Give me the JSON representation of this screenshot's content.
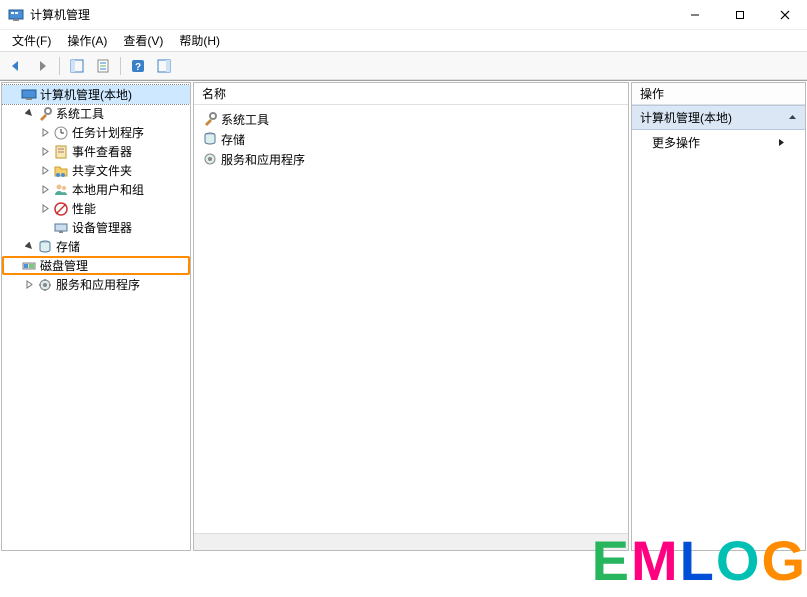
{
  "titlebar": {
    "title": "计算机管理"
  },
  "menu": {
    "file": "文件(F)",
    "action": "操作(A)",
    "view": "查看(V)",
    "help": "帮助(H)"
  },
  "tree": {
    "root": "计算机管理(本地)",
    "system_tools": "系统工具",
    "task_scheduler": "任务计划程序",
    "event_viewer": "事件查看器",
    "shared_folders": "共享文件夹",
    "local_users": "本地用户和组",
    "performance": "性能",
    "device_manager": "设备管理器",
    "storage": "存储",
    "disk_management": "磁盘管理",
    "services_apps": "服务和应用程序"
  },
  "list": {
    "header": "名称",
    "items": {
      "system_tools": "系统工具",
      "storage": "存储",
      "services_apps": "服务和应用程序"
    }
  },
  "actions": {
    "header": "操作",
    "section": "计算机管理(本地)",
    "more": "更多操作"
  },
  "watermark": "EMLOG"
}
